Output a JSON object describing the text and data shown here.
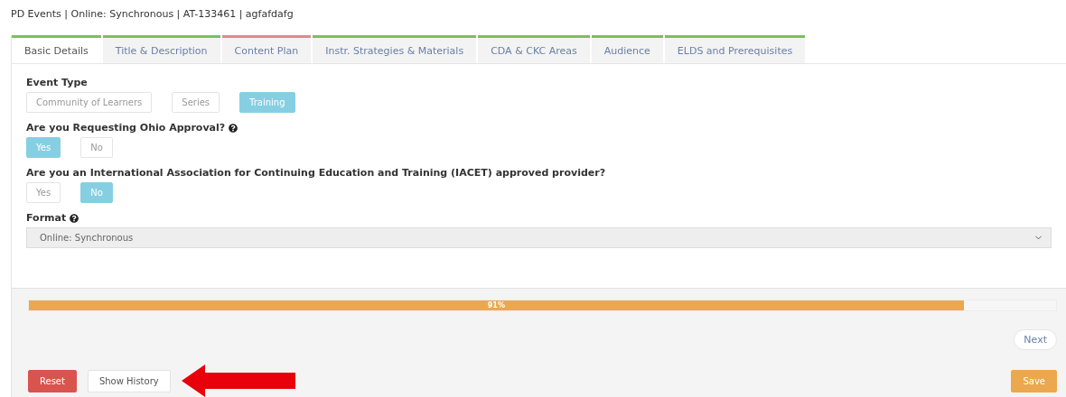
{
  "page_title": "PD Events | Online: Synchronous | AT-133461 | agfafdafg",
  "tabs": [
    {
      "label": "Basic Details",
      "selected": true,
      "color": "#7cc05a"
    },
    {
      "label": "Title & Description",
      "selected": false,
      "color": "#7cc05a"
    },
    {
      "label": "Content Plan",
      "selected": false,
      "color": "#e08a85"
    },
    {
      "label": "Instr. Strategies & Materials",
      "selected": false,
      "color": "#7cc05a"
    },
    {
      "label": "CDA & CKC Areas",
      "selected": false,
      "color": "#7cc05a"
    },
    {
      "label": "Audience",
      "selected": false,
      "color": "#7cc05a"
    },
    {
      "label": "ELDS and Prerequisites",
      "selected": false,
      "color": "#7cc05a"
    }
  ],
  "fields": [
    {
      "kind": "choice",
      "label": "Event Type",
      "help": false,
      "options": [
        {
          "label": "Community of Learners",
          "selected": false
        },
        {
          "label": "Series",
          "selected": false
        },
        {
          "label": "Training",
          "selected": true
        }
      ]
    },
    {
      "kind": "choice",
      "label": "Are you Requesting Ohio Approval?",
      "help": true,
      "options": [
        {
          "label": "Yes",
          "selected": true
        },
        {
          "label": "No",
          "selected": false
        }
      ]
    },
    {
      "kind": "choice",
      "label": "Are you an International Association for Continuing Education and Training (IACET) approved provider?",
      "help": false,
      "options": [
        {
          "label": "Yes",
          "selected": false
        },
        {
          "label": "No",
          "selected": true
        }
      ]
    },
    {
      "kind": "select",
      "label": "Format",
      "help": true,
      "value": "Online: Synchronous"
    }
  ],
  "progress": {
    "level": 0.91,
    "reading": "91%"
  },
  "buttons": {
    "next": "Next",
    "reset": "Reset",
    "show_history": "Show History",
    "save": "Save"
  }
}
